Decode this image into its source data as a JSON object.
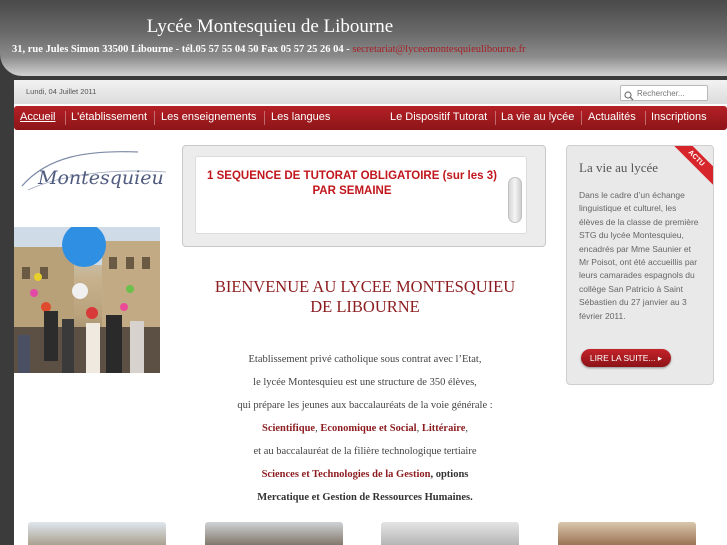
{
  "header": {
    "title": "Lycée Montesquieu de Libourne",
    "address": "31, rue Jules Simon 33500 Libourne - tél.05 57 55 04 50  Fax 05 57 25 26 04 - ",
    "email": "secretariat@lyceemontesquieulibourne.fr"
  },
  "topbar": {
    "date": "Lundi, 04 Juillet 2011",
    "search_placeholder": "Rechercher..."
  },
  "nav": {
    "items": [
      {
        "label": "Accueil"
      },
      {
        "label": "L'établissement"
      },
      {
        "label": "Les enseignements"
      },
      {
        "label": "Les langues"
      },
      {
        "label": "Le Dispositif Tutorat"
      },
      {
        "label": "La vie au lycée"
      },
      {
        "label": "Actualités"
      },
      {
        "label": "Inscriptions"
      }
    ]
  },
  "logo": {
    "text": "Montesquieu"
  },
  "ticker": {
    "line1": "1 SEQUENCE DE TUTORAT OBLIGATOIRE (sur les 3)",
    "line2": "PAR SEMAINE"
  },
  "main": {
    "title_line1": "BIENVENUE AU LYCEE MONTESQUIEU",
    "title_line2": "DE LIBOURNE",
    "p1": "Etablissement privé catholique sous contrat avec l’Etat,",
    "p2": "le lycée Montesquieu est une structure de 350 élèves,",
    "p3": "qui prépare les jeunes aux baccalauréats de la voie générale :",
    "p4a": "Scientifique",
    "p4b": ", ",
    "p4c": "Economique et Social",
    "p4d": ", ",
    "p4e": "Littéraire",
    "p4f": ",",
    "p5": "et au baccalauréat de la filière technologique tertiaire",
    "p6a": "Sciences et Technologies de la Gestion",
    "p6b": ", options",
    "p7": "Mercatique et  Gestion de Ressources Humaines."
  },
  "news": {
    "badge": "ACTU",
    "title": "La vie au lycée",
    "body": "Dans le cadre d’un échange linguistique et culturel, les élèves de la classe de première STG du lycée Montesquieu, encadrés par Mme Saunier et Mr Poisot, ont été accueillis par leurs camarades espagnols du collège San Patricio à Saint Sébastien du 27 janvier au 3 février 2011.",
    "read_more": "LIRE LA SUITE... ▸"
  }
}
